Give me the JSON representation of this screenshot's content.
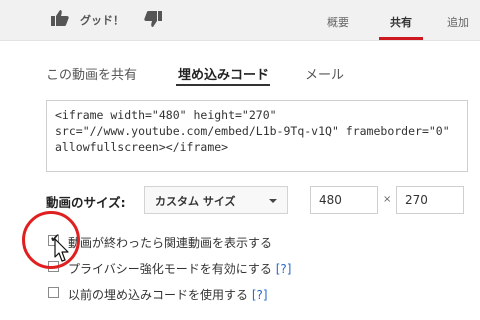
{
  "header": {
    "like_label": "グッド！",
    "tabs": [
      {
        "label": "概要"
      },
      {
        "label": "共有"
      },
      {
        "label": "追加"
      }
    ]
  },
  "share": {
    "subtabs": [
      {
        "label": "この動画を共有"
      },
      {
        "label": "埋め込みコード"
      },
      {
        "label": "メール"
      }
    ],
    "embed_code": "<iframe width=\"480\" height=\"270\"\nsrc=\"//www.youtube.com/embed/L1b-9Tq-v1Q\" frameborder=\"0\"\nallowfullscreen></iframe>"
  },
  "size": {
    "label": "動画のサイズ:",
    "select_value": "カスタム サイズ",
    "width": "480",
    "times": "×",
    "height": "270"
  },
  "options": [
    {
      "label": "動画が終わったら関連動画を表示する",
      "checked": true,
      "help": ""
    },
    {
      "label": "プライバシー強化モードを有効にする",
      "checked": false,
      "help": "[?]"
    },
    {
      "label": "以前の埋め込みコードを使用する",
      "checked": false,
      "help": "[?]"
    }
  ],
  "colors": {
    "accent_red": "#cc181e",
    "highlight_circle": "#e02020",
    "help_link": "#2a6ac8"
  },
  "icons": {
    "like": "thumbs-up-icon",
    "dislike": "thumbs-down-icon",
    "cursor": "mouse-cursor-icon"
  }
}
